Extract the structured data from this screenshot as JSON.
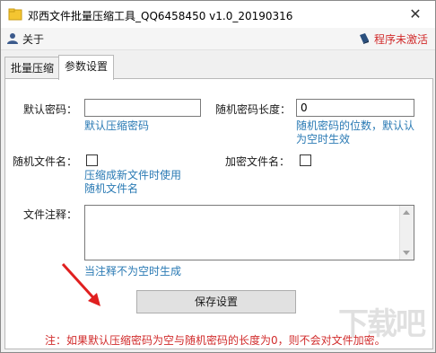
{
  "window": {
    "title": "邓西文件批量压缩工具_QQ6458450 v1.0_20190316",
    "close_label": "✕"
  },
  "menu": {
    "about_label": "关于",
    "status_label": "程序未激活"
  },
  "tabs": [
    {
      "label": "批量压缩",
      "active": false
    },
    {
      "label": "参数设置",
      "active": true
    }
  ],
  "form": {
    "default_password": {
      "label": "默认密码：",
      "value": "",
      "hint": "默认压缩密码"
    },
    "random_password_length": {
      "label": "随机密码长度：",
      "value": "0",
      "hint": "随机密码的位数，默认认为空时生效"
    },
    "random_filename": {
      "label": "随机文件名：",
      "checked": false,
      "hint_line1": "压缩成新文件时使用",
      "hint_line2": "随机文件名"
    },
    "encrypt_filename": {
      "label": "加密文件名：",
      "checked": false
    },
    "file_comment": {
      "label": "文件注释：",
      "value": "",
      "hint": "当注释不为空时生成"
    },
    "save_button": "保存设置",
    "note": "注：如果默认压缩密码为空与随机密码的长度为0，则不会对文件加密。"
  },
  "colors": {
    "hint": "#2a7ab4",
    "note": "#d12b2b",
    "arrow": "#e02020"
  },
  "watermark": "下载吧"
}
